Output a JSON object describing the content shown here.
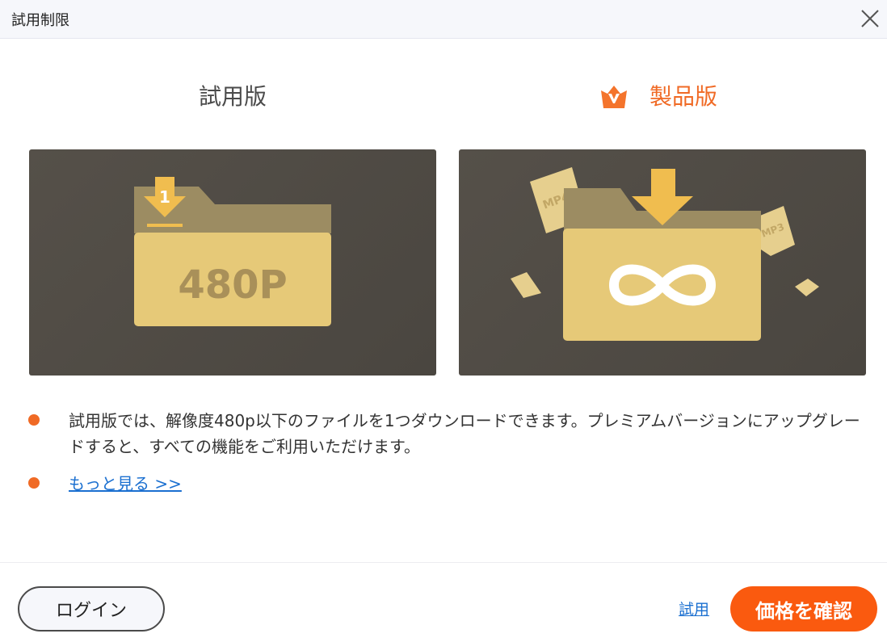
{
  "window": {
    "title": "試用制限"
  },
  "headings": {
    "trial": "試用版",
    "product": "製品版"
  },
  "cards": {
    "trial_badge": "480P",
    "trial_download_number": "1",
    "product_file_tags": [
      "MP4",
      "MP3"
    ],
    "product_symbol": "∞"
  },
  "bullets": {
    "description": "試用版では、解像度480p以下のファイルを1つダウンロードできます。プレミアムバージョンにアップグレードすると、すべての機能をご利用いただけます。",
    "more_link": "もっと見る >>"
  },
  "footer": {
    "login_label": "ログイン",
    "trial_link": "試用",
    "price_label": "価格を確認"
  },
  "colors": {
    "accent": "#fa5a0f",
    "link": "#1a6fd0",
    "card_bg": "#4f4b45",
    "folder_gold": "#e6c978"
  },
  "icons": {
    "close": "close-icon",
    "crown": "crown-v-icon",
    "download": "download-arrow-icon",
    "folder": "folder-icon",
    "infinity": "infinity-icon"
  }
}
